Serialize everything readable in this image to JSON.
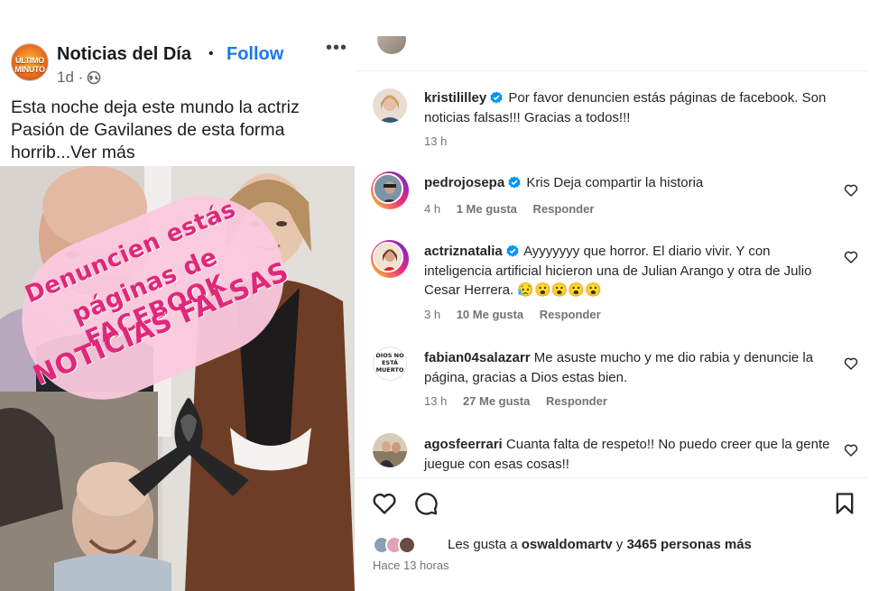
{
  "fb_post": {
    "avatar_text": "ÚLTIMO MINUTO",
    "page_name": "Noticias del Día",
    "dot": "•",
    "follow_label": "Follow",
    "more_label": "•••",
    "time": "1d ·",
    "text_line1": "Esta noche deja este mundo la actriz",
    "text_line2": "Pasión de Gavilanes de esta forma",
    "text_line3": "horrib...",
    "see_more": "Ver más",
    "stamp_line1": "Denuncien estás",
    "stamp_line2": "páginas de FACEBOOK",
    "stamp_line3": "NOTICIAS FALSAS"
  },
  "comments": [
    {
      "user": "kristililley",
      "verified": true,
      "text": "Por favor denuncien estás páginas de facebook. Son noticias falsas!!! Gracias a todos!!!",
      "time": "13 h",
      "likes": "",
      "reply": ""
    },
    {
      "user": "pedrojosepa",
      "verified": true,
      "text": "Kris Deja compartir la historia",
      "time": "4 h",
      "likes": "1 Me gusta",
      "reply": "Responder"
    },
    {
      "user": "actriznatalia",
      "verified": true,
      "text": "Ayyyyyyy que horror. El diario vivir. Y con inteligencia artificial hicieron una de Julian Arango y otra de Julio Cesar Herrera. 😥😮😮😮😮",
      "time": "3 h",
      "likes": "10 Me gusta",
      "reply": "Responder"
    },
    {
      "user": "fabian04salazarr",
      "verified": false,
      "avatar_text": "DIOS NO ESTÁ MUERTO",
      "text": "Me asuste mucho y me dio rabia y denuncie la página, gracias a Dios estas bien.",
      "time": "13 h",
      "likes": "27 Me gusta",
      "reply": "Responder"
    },
    {
      "user": "agosfeerrari",
      "verified": false,
      "text": "Cuanta falta de respeto!! No puedo creer que la gente juegue con esas cosas!!",
      "time": "",
      "likes": "",
      "reply": ""
    }
  ],
  "likes_summary": {
    "prefix": "Les gusta a ",
    "user": "oswaldomartv",
    "middle": " y ",
    "count": "3465 personas más"
  },
  "posted_ago": "Hace 13 horas",
  "colors": {
    "fb_blue": "#1877f2",
    "ig_verified": "#0095f6",
    "stamp_pink": "#fbc9de",
    "stamp_text": "#e0287a",
    "meta_grey": "#737373"
  },
  "icons": {
    "heart": "heart-icon",
    "comment": "comment-icon",
    "save": "bookmark-icon",
    "globe": "globe-icon",
    "verified": "verified-badge-icon"
  }
}
